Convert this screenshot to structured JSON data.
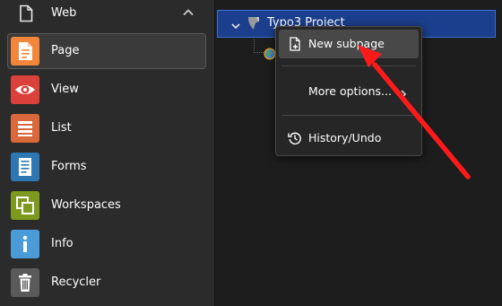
{
  "sidebar": {
    "group": {
      "label": "Web",
      "icon": "document-icon",
      "toggle_icon": "chevron-up-icon"
    },
    "modules": [
      {
        "label": "Page",
        "icon": "page-icon",
        "color": "#f3863b",
        "active": true
      },
      {
        "label": "View",
        "icon": "eye-icon",
        "color": "#d9413a",
        "active": false
      },
      {
        "label": "List",
        "icon": "list-icon",
        "color": "#d9683a",
        "active": false
      },
      {
        "label": "Forms",
        "icon": "forms-icon",
        "color": "#2d77b3",
        "active": false
      },
      {
        "label": "Workspaces",
        "icon": "workspaces-icon",
        "color": "#7d9a1e",
        "active": false
      },
      {
        "label": "Info",
        "icon": "info-icon",
        "color": "#4b9bd9",
        "active": false
      },
      {
        "label": "Recycler",
        "icon": "trash-icon",
        "color": "#5a5a5a",
        "active": false
      }
    ]
  },
  "tree": {
    "root": {
      "label": "Typo3 Project",
      "icon": "typo3-logo-icon",
      "expanded": true,
      "selected": true
    },
    "children": [
      {
        "icon": "globe-page-icon"
      }
    ],
    "selection_color": "#1b3f8c"
  },
  "context_menu": {
    "items": [
      {
        "label": "New subpage",
        "icon": "new-page-icon",
        "highlighted": true
      },
      {
        "label": "More options...",
        "icon": "chevron-right-icon",
        "has_submenu": true
      },
      {
        "label": "History/Undo",
        "icon": "history-icon"
      }
    ]
  },
  "annotation": {
    "type": "arrow",
    "color": "#ff1a1a",
    "points_to": "New subpage"
  }
}
